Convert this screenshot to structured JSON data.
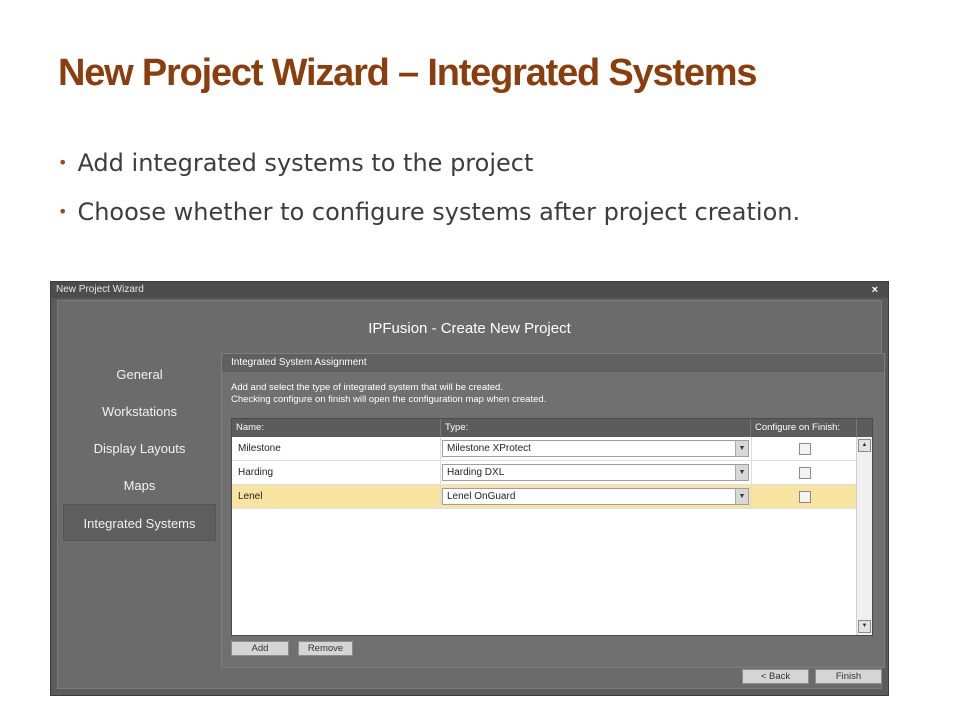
{
  "slide": {
    "title": "New Project Wizard – Integrated Systems",
    "bullets": [
      "Add integrated systems to the project",
      "Choose whether to configure systems after project creation."
    ]
  },
  "window": {
    "title": "New Project Wizard",
    "close": "×",
    "heading": "IPFusion - Create New Project"
  },
  "nav": {
    "items": [
      "General",
      "Workstations",
      "Display Layouts",
      "Maps",
      "Integrated Systems"
    ],
    "active": "Integrated Systems"
  },
  "group": {
    "title": "Integrated System Assignment",
    "desc1": "Add and select the type of integrated system that will be created.",
    "desc2": "Checking configure on finish will open the configuration map when created."
  },
  "grid": {
    "columns": [
      "Name:",
      "Type:",
      "Configure on Finish:"
    ],
    "rows": [
      {
        "name": "Milestone",
        "type": "Milestone XProtect",
        "configure": false
      },
      {
        "name": "Harding",
        "type": "Harding DXL",
        "configure": false
      },
      {
        "name": "Lenel",
        "type": "Lenel OnGuard",
        "configure": false
      }
    ],
    "selected_row": 2
  },
  "buttons": {
    "add": "Add",
    "remove": "Remove",
    "back": "< Back",
    "finish": "Finish"
  },
  "icons": {
    "dropdown": "▼",
    "scroll_up": "▲",
    "scroll_down": "▼",
    "bullet": "•"
  },
  "colors": {
    "title": "#8b3e0d",
    "selected_row": "#f8e3a1"
  }
}
